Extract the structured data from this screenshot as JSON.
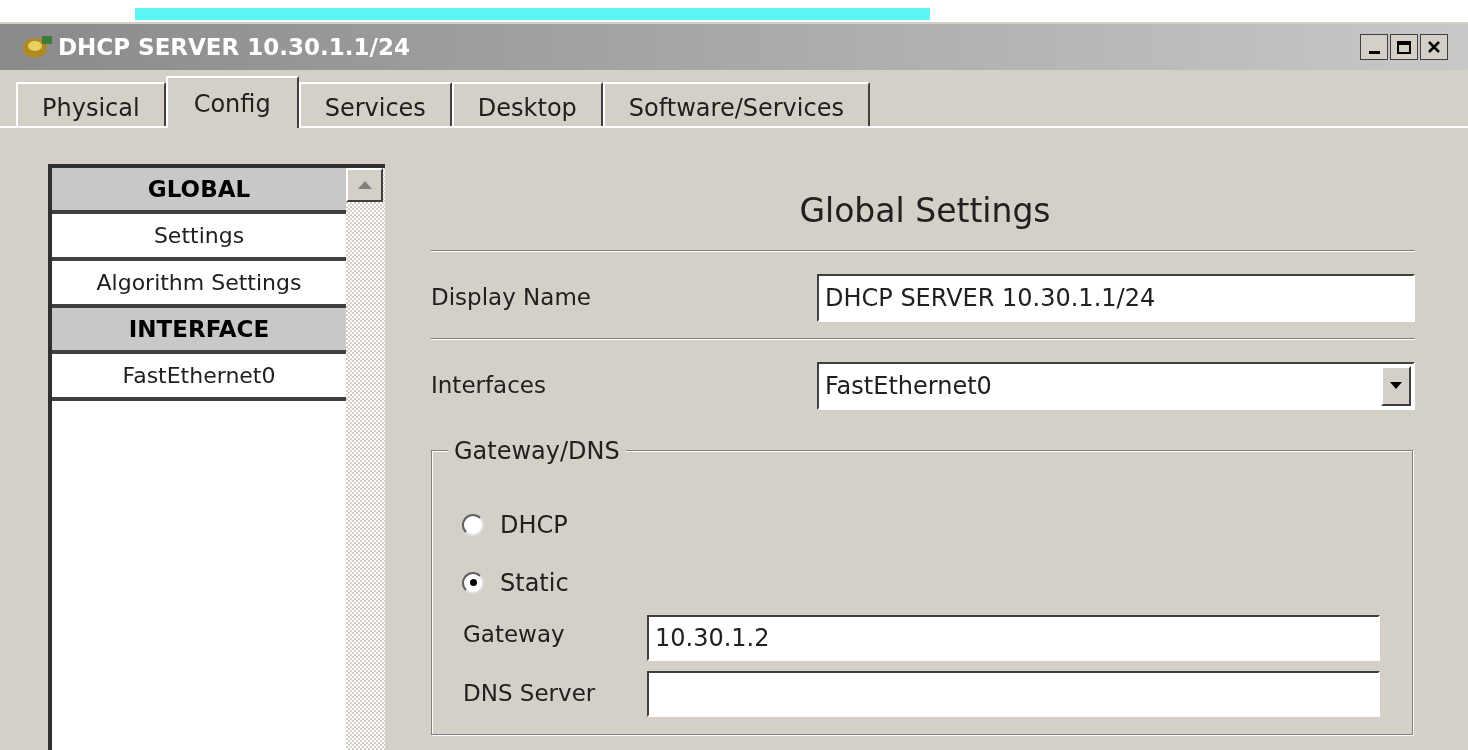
{
  "window": {
    "title": "DHCP SERVER 10.30.1.1/24"
  },
  "tabs": [
    {
      "label": "Physical",
      "selected": false
    },
    {
      "label": "Config",
      "selected": true
    },
    {
      "label": "Services",
      "selected": false
    },
    {
      "label": "Desktop",
      "selected": false
    },
    {
      "label": "Software/Services",
      "selected": false
    }
  ],
  "sidebar": {
    "items": [
      {
        "kind": "header",
        "label": "GLOBAL"
      },
      {
        "kind": "item",
        "label": "Settings"
      },
      {
        "kind": "item",
        "label": "Algorithm Settings"
      },
      {
        "kind": "header",
        "label": "INTERFACE"
      },
      {
        "kind": "item",
        "label": "FastEthernet0"
      }
    ]
  },
  "panel": {
    "title": "Global Settings",
    "display_name": {
      "label": "Display Name",
      "value": "DHCP SERVER 10.30.1.1/24"
    },
    "interfaces": {
      "label": "Interfaces",
      "value": "FastEthernet0"
    },
    "gateway_dns": {
      "legend": "Gateway/DNS",
      "options": [
        {
          "label": "DHCP",
          "selected": false
        },
        {
          "label": "Static",
          "selected": true
        }
      ],
      "gateway": {
        "label": "Gateway",
        "value": "10.30.1.2"
      },
      "dns_server": {
        "label": "DNS Server"
      }
    }
  }
}
